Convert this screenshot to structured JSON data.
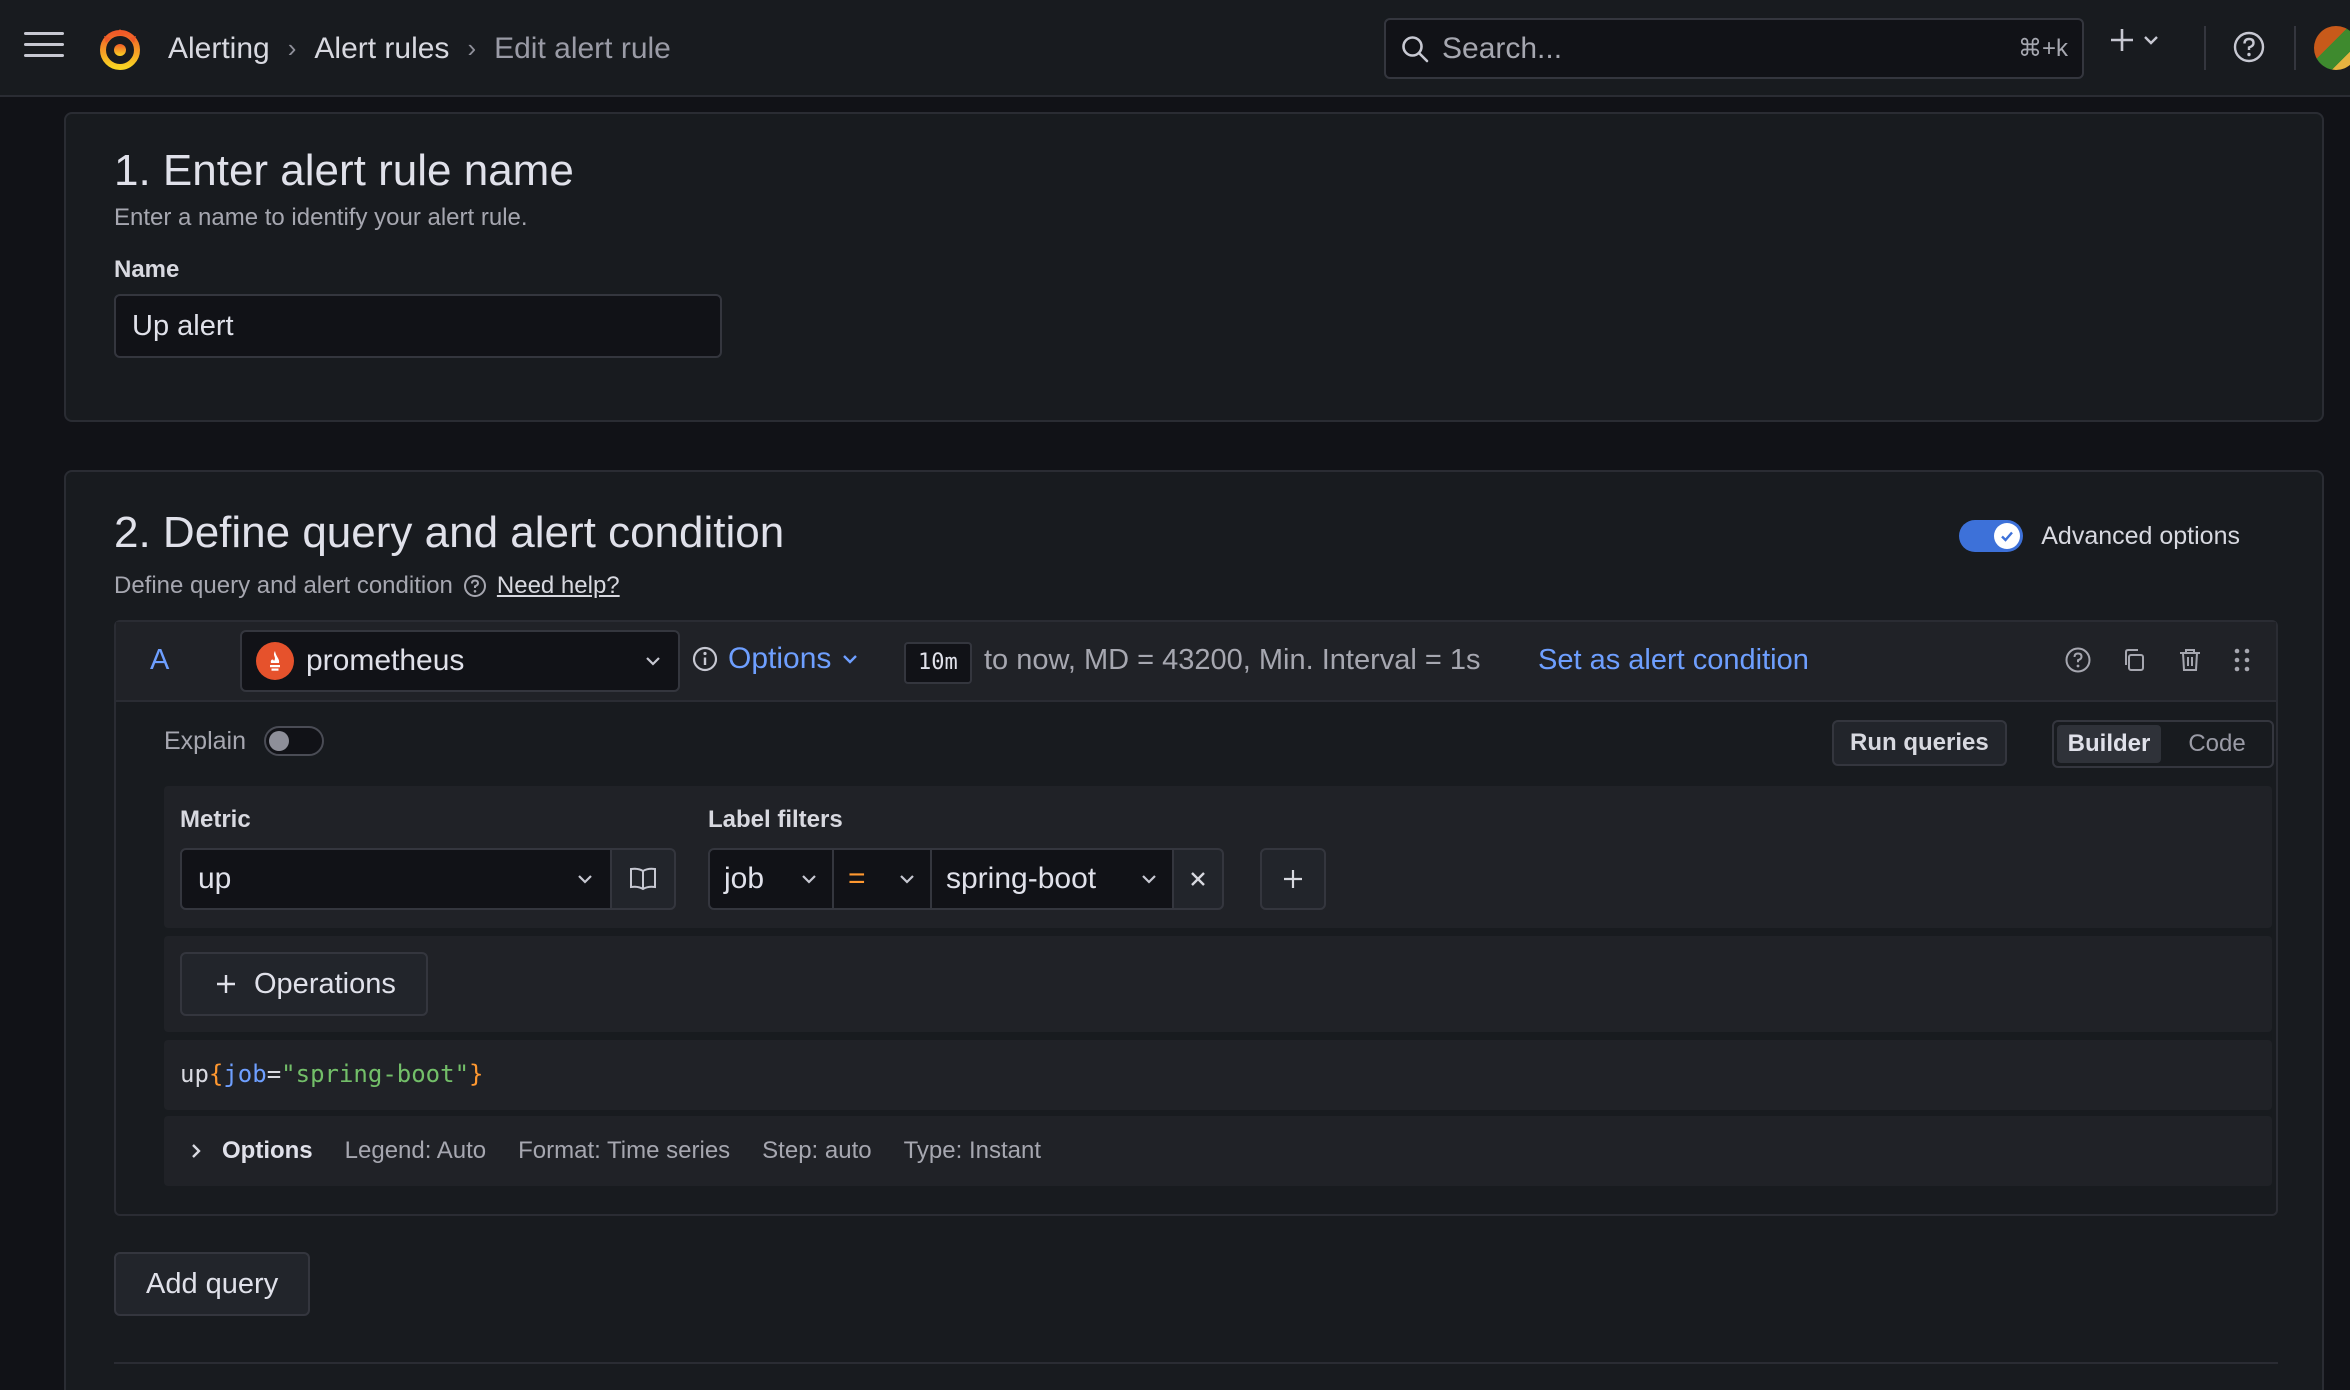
{
  "header": {
    "breadcrumbs": [
      "Alerting",
      "Alert rules",
      "Edit alert rule"
    ],
    "search_placeholder": "Search...",
    "search_shortcut": "⌘+k"
  },
  "section1": {
    "title": "1. Enter alert rule name",
    "description": "Enter a name to identify your alert rule.",
    "name_label": "Name",
    "name_value": "Up alert"
  },
  "section2": {
    "title": "2. Define query and alert condition",
    "description": "Define query and alert condition",
    "help_link": "Need help?",
    "advanced_options_label": "Advanced options",
    "advanced_options_enabled": true
  },
  "query": {
    "ref_id": "A",
    "datasource": "prometheus",
    "options_label": "Options",
    "interval_chip": "10m",
    "interval_text": "to now, MD = 43200, Min. Interval = 1s",
    "set_condition_label": "Set as alert condition",
    "explain_label": "Explain",
    "explain_enabled": false,
    "run_queries_label": "Run queries",
    "mode_builder": "Builder",
    "mode_code": "Code",
    "metric_label": "Metric",
    "metric_value": "up",
    "label_filters_label": "Label filters",
    "filter_key": "job",
    "filter_op": "=",
    "filter_value": "spring-boot",
    "operations_label": "Operations",
    "promql": {
      "metric": "up",
      "open": "{",
      "key": "job",
      "eq": "=",
      "value": "\"spring-boot\"",
      "close": "}"
    },
    "options_row": {
      "title": "Options",
      "legend": "Legend: Auto",
      "format": "Format: Time series",
      "step": "Step: auto",
      "type": "Type: Instant"
    }
  },
  "add_query_label": "Add query",
  "colors": {
    "background": "#111217",
    "panel": "#181b1f",
    "accent_blue": "#6e9fff",
    "toggle_on": "#3d71d9",
    "brand_orange": "#f46800",
    "prometheus": "#e6522c"
  }
}
